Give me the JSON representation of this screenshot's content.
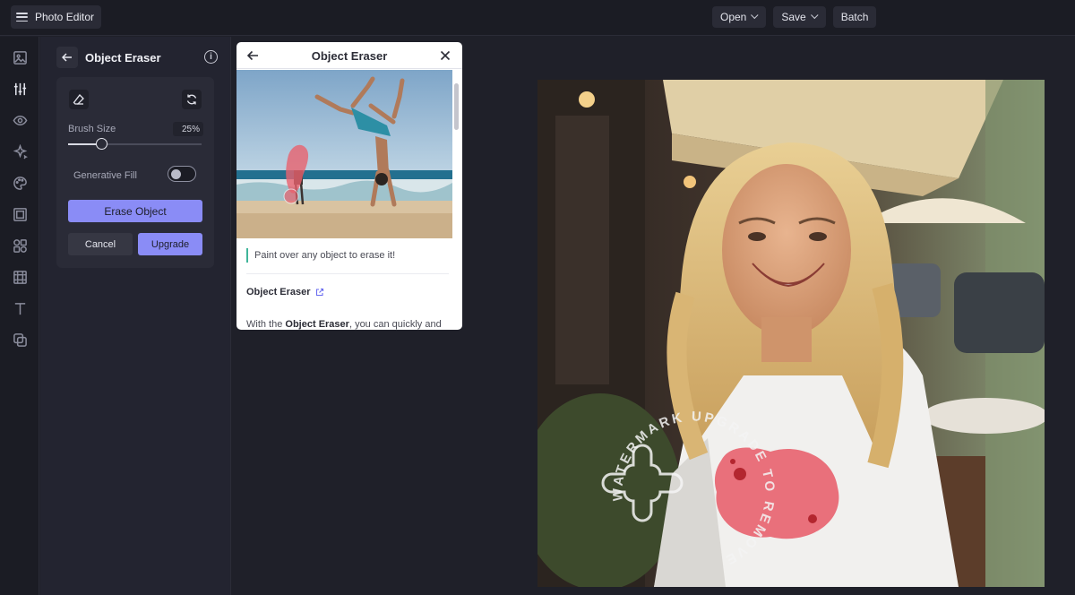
{
  "app": {
    "title": "Photo Editor"
  },
  "top_actions": [
    {
      "label": "Open",
      "has_dropdown": true
    },
    {
      "label": "Save",
      "has_dropdown": true
    },
    {
      "label": "Batch",
      "has_dropdown": false
    }
  ],
  "rail": {
    "icons": [
      "image-icon",
      "adjust-sliders-icon",
      "eye-icon",
      "sparkle-icon",
      "palette-icon",
      "frame-icon",
      "elements-icon",
      "texture-icon",
      "text-icon",
      "layers-icon"
    ],
    "active": "adjust-sliders-icon"
  },
  "panel": {
    "title": "Object Eraser",
    "brush_size_label": "Brush Size",
    "brush_size_value": "25%",
    "brush_size_fraction": 0.25,
    "generative_fill_label": "Generative Fill",
    "generative_fill_on": false,
    "erase_button": "Erase Object",
    "cancel_button": "Cancel",
    "upgrade_button": "Upgrade"
  },
  "help_popup": {
    "title": "Object Eraser",
    "tip": "Paint over any object to erase it!",
    "link_label": "Object Eraser",
    "body_prefix": "With the ",
    "body_bold": "Object Eraser",
    "body_suffix": ", you can quickly and"
  },
  "canvas": {
    "watermark_text": "WATERMARK UPGRADE TO REMOVE"
  },
  "colors": {
    "accent": "#8a8cf6",
    "app_bg": "#1f2029",
    "panel_bg": "#232430",
    "tip_border": "#3fb59a",
    "eraser_mask": "#e8626e"
  }
}
